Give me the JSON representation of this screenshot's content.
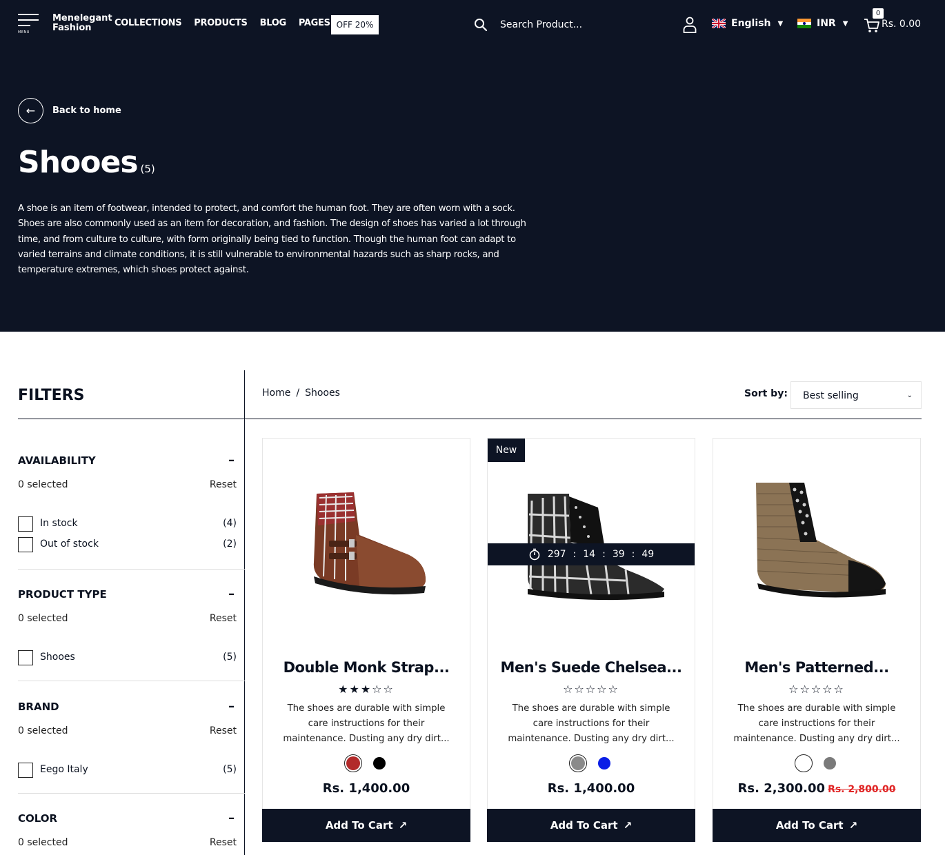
{
  "header": {
    "menu_word": "MENU",
    "logo": "Menelegant Fashion",
    "nav": [
      "COLLECTIONS",
      "PRODUCTS",
      "BLOG",
      "PAGES"
    ],
    "promo_badge": "OFF 20%",
    "search_placeholder": "Search Product...",
    "language": "English",
    "currency": "INR",
    "cart_count": "0",
    "cart_total": "Rs. 0.00"
  },
  "hero": {
    "back_label": "Back to home",
    "title": "Shooes",
    "count": "(5)",
    "description": "A shoe is an item of footwear, intended to protect, and comfort the human foot. They are often worn with a sock. Shoes are also commonly used as an item for decoration, and fashion. The design of shoes has varied a lot through time, and from culture to culture, with form originally being tied to function. Though the human foot can adapt to varied terrains and climate conditions, it is still vulnerable to environmental hazards such as sharp rocks, and temperature extremes, which shoes protect against."
  },
  "filters": {
    "title": "FILTERS",
    "groups": [
      {
        "title": "AVAILABILITY",
        "selected": "0 selected",
        "reset": "Reset",
        "options": [
          {
            "label": "In stock",
            "count": "(4)"
          },
          {
            "label": "Out of stock",
            "count": "(2)"
          }
        ]
      },
      {
        "title": "PRODUCT TYPE",
        "selected": "0 selected",
        "reset": "Reset",
        "options": [
          {
            "label": "Shooes",
            "count": "(5)"
          }
        ]
      },
      {
        "title": "BRAND",
        "selected": "0 selected",
        "reset": "Reset",
        "options": [
          {
            "label": "Eego Italy",
            "count": "(5)"
          }
        ]
      },
      {
        "title": "COLOR",
        "selected": "0 selected",
        "reset": "Reset",
        "options": []
      }
    ]
  },
  "breadcrumb": {
    "home": "Home",
    "sep": "/",
    "current": "Shooes"
  },
  "sort": {
    "label": "Sort by:",
    "value": "Best selling"
  },
  "products": [
    {
      "name": "Double Monk Strap...",
      "rating": 3,
      "stars": "★★★☆☆",
      "description": "The shoes are durable with simple care instructions for their maintenance. Dusting any dry dirt...",
      "swatches": [
        "#b22a2a",
        "#000000"
      ],
      "price": "Rs. 1,400.00",
      "old_price": "",
      "button": "Add To Cart"
    },
    {
      "name": "Men's Suede Chelsea...",
      "rating": 0,
      "stars": "☆☆☆☆☆",
      "badge": "New",
      "timer": {
        "days": "297",
        "hours": "14",
        "minutes": "39",
        "seconds": "49"
      },
      "description": "The shoes are durable with simple care instructions for their maintenance. Dusting any dry dirt...",
      "swatches": [
        "#8a8a8a",
        "#0a1ee6"
      ],
      "price": "Rs. 1,400.00",
      "old_price": "",
      "button": "Add To Cart"
    },
    {
      "name": "Men's Patterned...",
      "rating": 0,
      "stars": "☆☆☆☆☆",
      "description": "The shoes are durable with simple care instructions for their maintenance. Dusting any dry dirt...",
      "swatches": [
        "#ffffff",
        "#7a7a7a"
      ],
      "price": "Rs. 2,300.00",
      "old_price": "Rs. 2,800.00",
      "button": "Add To Cart"
    }
  ],
  "colors": {
    "navy": "#0d1424",
    "sale_red": "#e02424"
  }
}
